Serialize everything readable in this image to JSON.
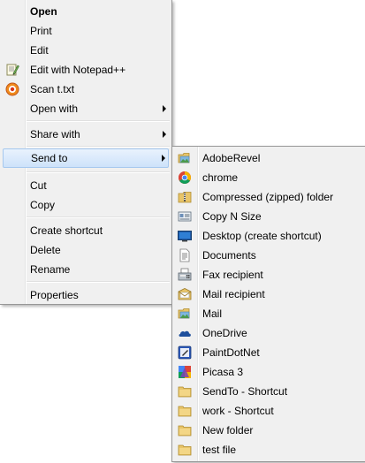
{
  "main_menu": {
    "open": "Open",
    "print": "Print",
    "edit": "Edit",
    "edit_notepad": "Edit with Notepad++",
    "scan": "Scan t.txt",
    "open_with": "Open with",
    "share_with": "Share with",
    "send_to": "Send to",
    "cut": "Cut",
    "copy": "Copy",
    "create_shortcut": "Create shortcut",
    "delete": "Delete",
    "rename": "Rename",
    "properties": "Properties"
  },
  "send_to_menu": {
    "items": [
      {
        "label": "AdobeRevel",
        "icon": "folder-image-icon"
      },
      {
        "label": "chrome",
        "icon": "chrome-icon"
      },
      {
        "label": "Compressed (zipped) folder",
        "icon": "zip-folder-icon"
      },
      {
        "label": "Copy N Size",
        "icon": "copy-n-size-icon"
      },
      {
        "label": "Desktop (create shortcut)",
        "icon": "desktop-icon"
      },
      {
        "label": "Documents",
        "icon": "documents-icon"
      },
      {
        "label": "Fax recipient",
        "icon": "fax-icon"
      },
      {
        "label": "Mail recipient",
        "icon": "mail-recipient-icon"
      },
      {
        "label": "Mail",
        "icon": "folder-image-icon"
      },
      {
        "label": "OneDrive",
        "icon": "onedrive-icon"
      },
      {
        "label": "PaintDotNet",
        "icon": "paintdotnet-icon"
      },
      {
        "label": "Picasa 3",
        "icon": "picasa-icon"
      },
      {
        "label": "SendTo - Shortcut",
        "icon": "folder-icon"
      },
      {
        "label": "work - Shortcut",
        "icon": "folder-icon"
      },
      {
        "label": "New folder",
        "icon": "folder-icon"
      },
      {
        "label": "test file",
        "icon": "folder-icon"
      }
    ]
  },
  "colors": {
    "menu_bg": "#f0f0f0",
    "menu_border": "#979797",
    "highlight_top": "#e9f2fd",
    "highlight_bottom": "#cde2fa",
    "highlight_border": "#a6c8ee",
    "folder_yellow": "#e8c468"
  }
}
